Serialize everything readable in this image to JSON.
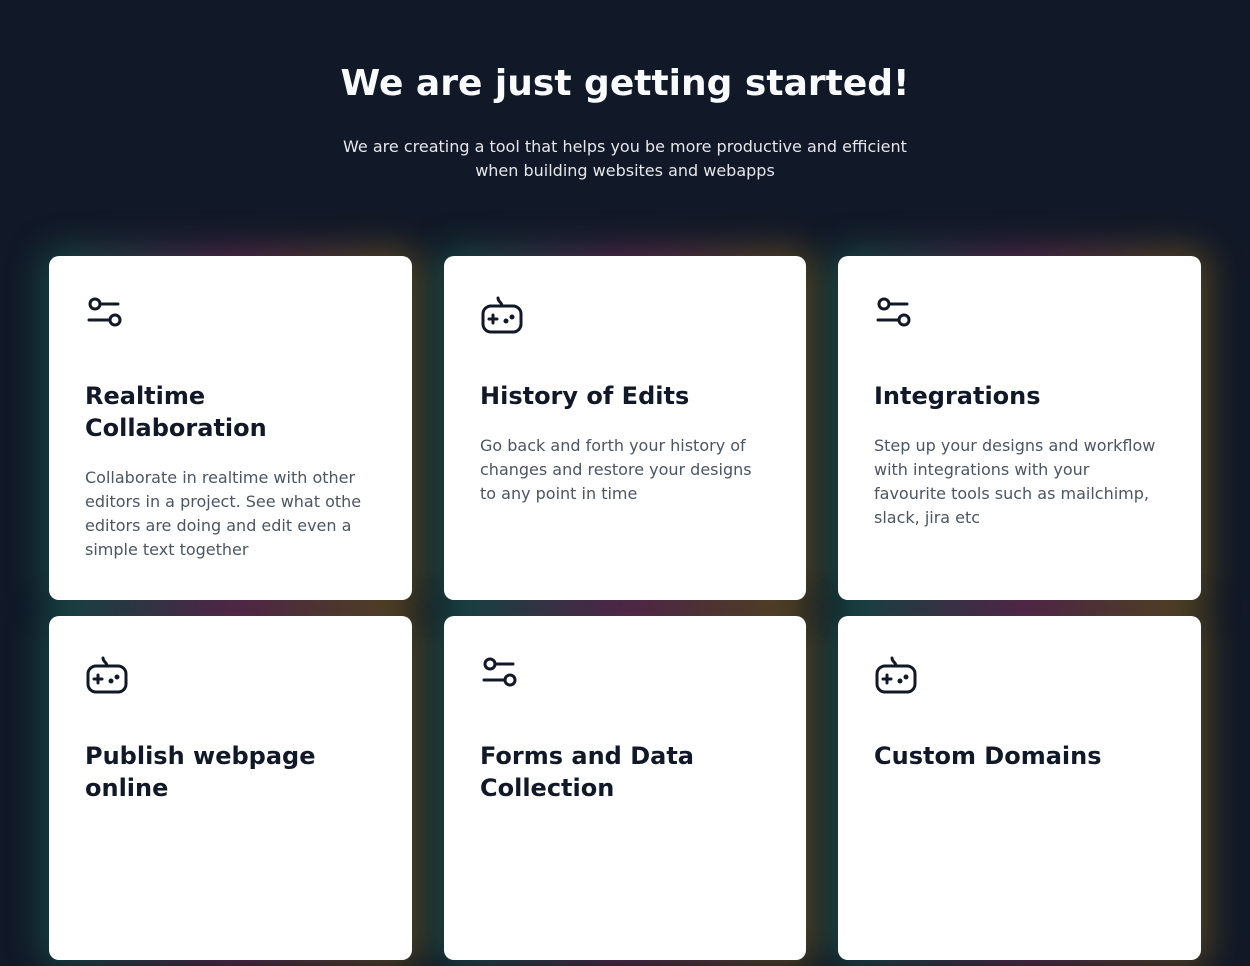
{
  "hero": {
    "title": "We are just getting started!",
    "subtitle": "We are creating a tool that helps you be more productive and efficient when building websites and webapps"
  },
  "features": [
    {
      "icon": "sliders-icon",
      "title": "Realtime Collaboration",
      "description": "Collaborate in realtime with other editors in a project. See what othe editors are doing and edit even a simple text together"
    },
    {
      "icon": "gamepad-icon",
      "title": "History of Edits",
      "description": "Go back and forth your history of changes and restore your designs to any point in time"
    },
    {
      "icon": "sliders-icon",
      "title": "Integrations",
      "description": "Step up your designs and workflow with integrations with your favourite tools such as mailchimp, slack, jira etc"
    },
    {
      "icon": "gamepad-icon",
      "title": "Publish webpage online",
      "description": ""
    },
    {
      "icon": "sliders-icon",
      "title": "Forms and Data Collection",
      "description": ""
    },
    {
      "icon": "gamepad-icon",
      "title": "Custom Domains",
      "description": ""
    }
  ]
}
